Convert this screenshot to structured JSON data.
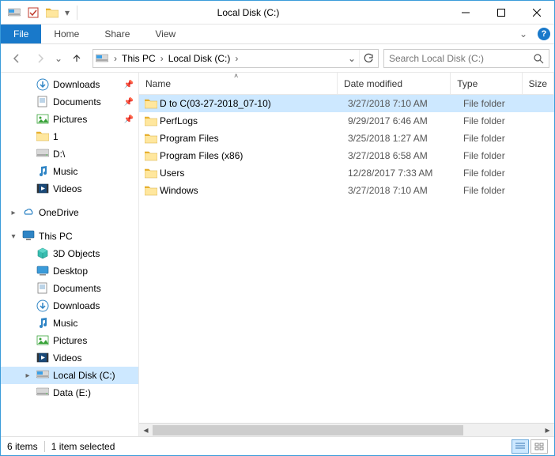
{
  "window": {
    "title": "Local Disk (C:)"
  },
  "ribbon": {
    "file": "File",
    "tabs": [
      "Home",
      "Share",
      "View"
    ]
  },
  "breadcrumb": {
    "root": "This PC",
    "current": "Local Disk (C:)"
  },
  "search": {
    "placeholder": "Search Local Disk (C:)"
  },
  "nav": {
    "quick": [
      {
        "label": "Downloads",
        "icon": "downloads",
        "pinned": true
      },
      {
        "label": "Documents",
        "icon": "documents",
        "pinned": true
      },
      {
        "label": "Pictures",
        "icon": "pictures",
        "pinned": true
      },
      {
        "label": "1",
        "icon": "folder",
        "pinned": false
      },
      {
        "label": "D:\\",
        "icon": "disk",
        "pinned": false
      },
      {
        "label": "Music",
        "icon": "music",
        "pinned": false
      },
      {
        "label": "Videos",
        "icon": "videos",
        "pinned": false
      }
    ],
    "onedrive": "OneDrive",
    "thispc_label": "This PC",
    "thispc": [
      {
        "label": "3D Objects",
        "icon": "3d"
      },
      {
        "label": "Desktop",
        "icon": "desktop"
      },
      {
        "label": "Documents",
        "icon": "documents"
      },
      {
        "label": "Downloads",
        "icon": "downloads"
      },
      {
        "label": "Music",
        "icon": "music"
      },
      {
        "label": "Pictures",
        "icon": "pictures"
      },
      {
        "label": "Videos",
        "icon": "videos"
      },
      {
        "label": "Local Disk (C:)",
        "icon": "disk-c",
        "selected": true
      },
      {
        "label": "Data (E:)",
        "icon": "disk"
      }
    ]
  },
  "columns": {
    "name": "Name",
    "date": "Date modified",
    "type": "Type",
    "size": "Size"
  },
  "files": [
    {
      "name": "D to C(03-27-2018_07-10)",
      "date": "3/27/2018 7:10 AM",
      "type": "File folder",
      "selected": true
    },
    {
      "name": "PerfLogs",
      "date": "9/29/2017 6:46 AM",
      "type": "File folder"
    },
    {
      "name": "Program Files",
      "date": "3/25/2018 1:27 AM",
      "type": "File folder"
    },
    {
      "name": "Program Files (x86)",
      "date": "3/27/2018 6:58 AM",
      "type": "File folder"
    },
    {
      "name": "Users",
      "date": "12/28/2017 7:33 AM",
      "type": "File folder"
    },
    {
      "name": "Windows",
      "date": "3/27/2018 7:10 AM",
      "type": "File folder"
    }
  ],
  "status": {
    "count": "6 items",
    "selection": "1 item selected"
  }
}
